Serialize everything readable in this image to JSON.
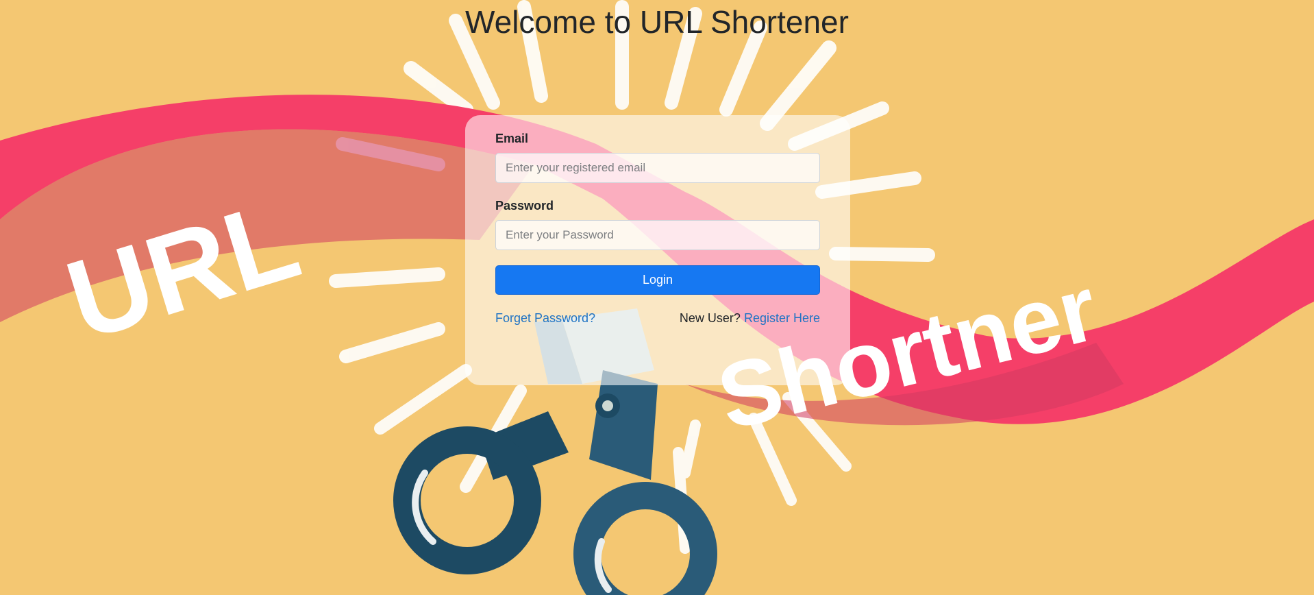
{
  "page": {
    "title": "Welcome to URL Shortener"
  },
  "background": {
    "ribbon_left_text": "URL",
    "ribbon_right_text": "Shortner"
  },
  "login_form": {
    "email_label": "Email",
    "email_placeholder": "Enter your registered email",
    "email_value": "",
    "password_label": "Password",
    "password_placeholder": "Enter your Password",
    "password_value": "",
    "login_button_label": "Login",
    "forgot_password_link": "Forget Password?",
    "new_user_text": "New User?",
    "register_link": "Register Here"
  },
  "colors": {
    "background": "#f4c772",
    "ribbon": "#f53f68",
    "scissors": "#1d4a63",
    "primary_button": "#1678f2",
    "link": "#1f73c4"
  },
  "icons": [
    "scissors-illustration"
  ]
}
